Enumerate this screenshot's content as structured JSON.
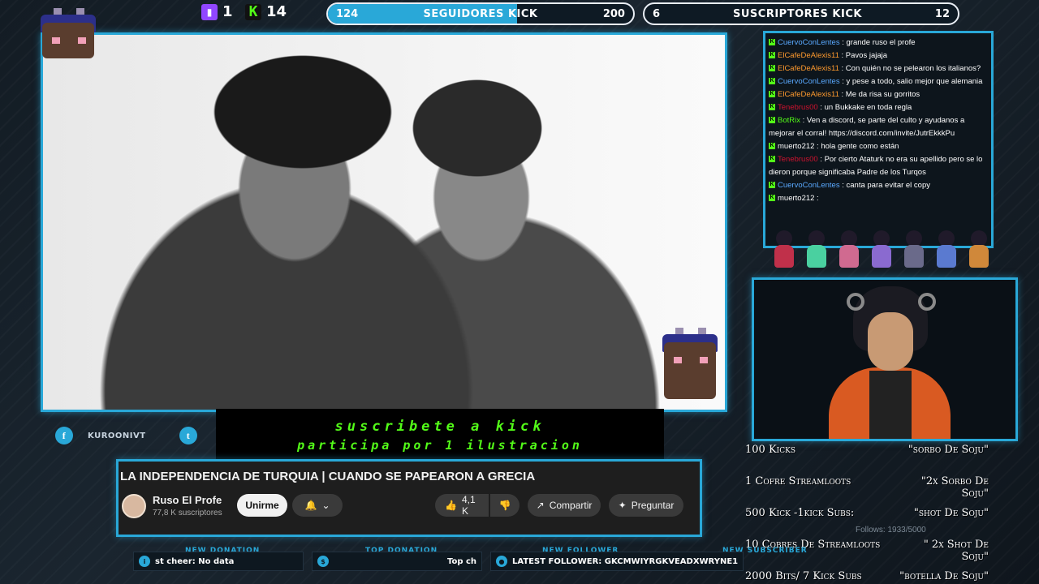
{
  "top_stats": {
    "twitch_count": "1",
    "kick_count": "14",
    "kick_icon": "K",
    "followers_goal": {
      "start": "124",
      "label": "SEGUIDORES KICK",
      "end": "200",
      "progress": 0.62,
      "color": "#29a8d8"
    },
    "subs_goal": {
      "start": "6",
      "label": "SUSCRIPTORES KICK",
      "end": "12",
      "progress": 0.0,
      "color": "#ffffff"
    }
  },
  "chat": {
    "messages": [
      {
        "user": "CuervoConLentes",
        "color": "#5aa9ff",
        "text": "grande ruso el profe"
      },
      {
        "user": "ElCafeDeAlexis11",
        "color": "#ff9a2e",
        "text": "Pavos jajaja"
      },
      {
        "user": "ElCafeDeAlexis11",
        "color": "#ff9a2e",
        "text": "Con quién no se pelearon los italianos?"
      },
      {
        "user": "CuervoConLentes",
        "color": "#5aa9ff",
        "text": "y pese a todo, salio mejor que alemania"
      },
      {
        "user": "ElCafeDeAlexis11",
        "color": "#ff9a2e",
        "text": "Me da risa su gorritos"
      },
      {
        "user": "Tenebrus00",
        "color": "#d1122f",
        "text": "un Bukkake en toda regla"
      },
      {
        "user": "BotRix",
        "color": "#53fc18",
        "text": "Ven a discord, se parte del culto y ayudanos a mejorar el corral! https://discord.com/invite/JutrEkkkPu"
      },
      {
        "user": "muerto212",
        "color": "#ffffff",
        "text": "hola gente como están"
      },
      {
        "user": "Tenebrus00",
        "color": "#d1122f",
        "text": "Por cierto Ataturk no era su apellido pero se lo dieron porque significaba Padre de los Turqos"
      },
      {
        "user": "CuervoConLentes",
        "color": "#5aa9ff",
        "text": "canta para evitar el copy"
      },
      {
        "user": "muerto212",
        "color": "#ffffff",
        "text": ""
      }
    ]
  },
  "commands": [
    {
      "left": "100 Kicks",
      "right": "\"sorbo De Soju\""
    },
    {
      "left": "1 Cofre Streamloots",
      "right": "\"2x Sorbo De Soju\""
    },
    {
      "left": "500 Kick -1kick Subs:",
      "right": "\"shot De Soju\""
    },
    {
      "left": "10 Cobres De Streamloots",
      "right": "\" 2x Shot De Soju\""
    },
    {
      "left": "2000 Bits/ 7 Kick Subs",
      "right": "\"botella De Soju\""
    }
  ],
  "follows_text": "Follows: 1933/5000",
  "socials": {
    "facebook_handle": "KUROONIVT",
    "facebook_icon": "f",
    "twitter_icon": "t"
  },
  "promo": {
    "line1": "suscribete a kick",
    "line2": "participa por 1 ilustracion"
  },
  "youtube": {
    "title": "LA INDEPENDENCIA DE TURQUIA | CUANDO SE PAPEARON A GRECIA",
    "channel": "Ruso El Profe",
    "subscribers": "77,8 K suscriptores",
    "join_label": "Unirme",
    "likes": "4,1 K",
    "share_label": "Compartir",
    "ask_label": "Preguntar"
  },
  "ticker": {
    "new_donation_label": "NEW DONATION",
    "top_donation_label": "TOP DONATION",
    "new_follower_label": "NEW FOLLOWER",
    "new_sub_label": "NEW SUBSCRIBER",
    "cheer_text": "st cheer: No data",
    "top_text": "Top ch",
    "latest_follower": "LATEST FOLLOWER: GKCMWIYRGKVEADXWRYNE1"
  }
}
